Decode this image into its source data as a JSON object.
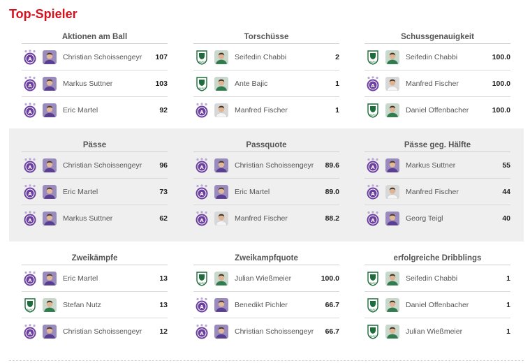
{
  "title": "Top-Spieler",
  "colors": {
    "title": "#d6111e",
    "austria": "#6b3fa0",
    "rapid": "#1e6b3c"
  },
  "bands": [
    {
      "panels": [
        {
          "title": "Aktionen am Ball",
          "rows": [
            {
              "club": "austria",
              "kit": "purple",
              "name": "Christian Schoissengeyr",
              "value": "107"
            },
            {
              "club": "austria",
              "kit": "purple",
              "name": "Markus Suttner",
              "value": "103"
            },
            {
              "club": "austria",
              "kit": "purple",
              "name": "Eric Martel",
              "value": "92"
            }
          ]
        },
        {
          "title": "Torschüsse",
          "rows": [
            {
              "club": "rapid",
              "kit": "green",
              "name": "Seifedin Chabbi",
              "value": "2"
            },
            {
              "club": "rapid",
              "kit": "green",
              "name": "Ante Bajic",
              "value": "1"
            },
            {
              "club": "austria",
              "kit": "white",
              "name": "Manfred Fischer",
              "value": "1"
            }
          ]
        },
        {
          "title": "Schussgenauigkeit",
          "rows": [
            {
              "club": "rapid",
              "kit": "green",
              "name": "Seifedin Chabbi",
              "value": "100.0"
            },
            {
              "club": "austria",
              "kit": "white",
              "name": "Manfred Fischer",
              "value": "100.0"
            },
            {
              "club": "rapid",
              "kit": "green",
              "name": "Daniel Offenbacher",
              "value": "100.0"
            }
          ]
        }
      ]
    },
    {
      "panels": [
        {
          "title": "Pässe",
          "rows": [
            {
              "club": "austria",
              "kit": "purple",
              "name": "Christian Schoissengeyr",
              "value": "96"
            },
            {
              "club": "austria",
              "kit": "purple",
              "name": "Eric Martel",
              "value": "73"
            },
            {
              "club": "austria",
              "kit": "purple",
              "name": "Markus Suttner",
              "value": "62"
            }
          ]
        },
        {
          "title": "Passquote",
          "rows": [
            {
              "club": "austria",
              "kit": "purple",
              "name": "Christian Schoissengeyr",
              "value": "89.6"
            },
            {
              "club": "austria",
              "kit": "purple",
              "name": "Eric Martel",
              "value": "89.0"
            },
            {
              "club": "austria",
              "kit": "white",
              "name": "Manfred Fischer",
              "value": "88.2"
            }
          ]
        },
        {
          "title": "Pässe geg. Hälfte",
          "rows": [
            {
              "club": "austria",
              "kit": "purple",
              "name": "Markus Suttner",
              "value": "55"
            },
            {
              "club": "austria",
              "kit": "white",
              "name": "Manfred Fischer",
              "value": "44"
            },
            {
              "club": "austria",
              "kit": "purple",
              "name": "Georg Teigl",
              "value": "40"
            }
          ]
        }
      ]
    },
    {
      "panels": [
        {
          "title": "Zweikämpfe",
          "rows": [
            {
              "club": "austria",
              "kit": "purple",
              "name": "Eric Martel",
              "value": "13"
            },
            {
              "club": "rapid",
              "kit": "green",
              "name": "Stefan Nutz",
              "value": "13"
            },
            {
              "club": "austria",
              "kit": "purple",
              "name": "Christian Schoissengeyr",
              "value": "12"
            }
          ]
        },
        {
          "title": "Zweikampfquote",
          "rows": [
            {
              "club": "rapid",
              "kit": "green",
              "name": "Julian Wießmeier",
              "value": "100.0"
            },
            {
              "club": "austria",
              "kit": "purple",
              "name": "Benedikt Pichler",
              "value": "66.7"
            },
            {
              "club": "austria",
              "kit": "purple",
              "name": "Christian Schoissengeyr",
              "value": "66.7"
            }
          ]
        },
        {
          "title": "erfolgreiche Dribblings",
          "rows": [
            {
              "club": "rapid",
              "kit": "green",
              "name": "Seifedin Chabbi",
              "value": "1"
            },
            {
              "club": "rapid",
              "kit": "green",
              "name": "Daniel Offenbacher",
              "value": "1"
            },
            {
              "club": "rapid",
              "kit": "green",
              "name": "Julian Wießmeier",
              "value": "1"
            }
          ]
        }
      ]
    }
  ]
}
